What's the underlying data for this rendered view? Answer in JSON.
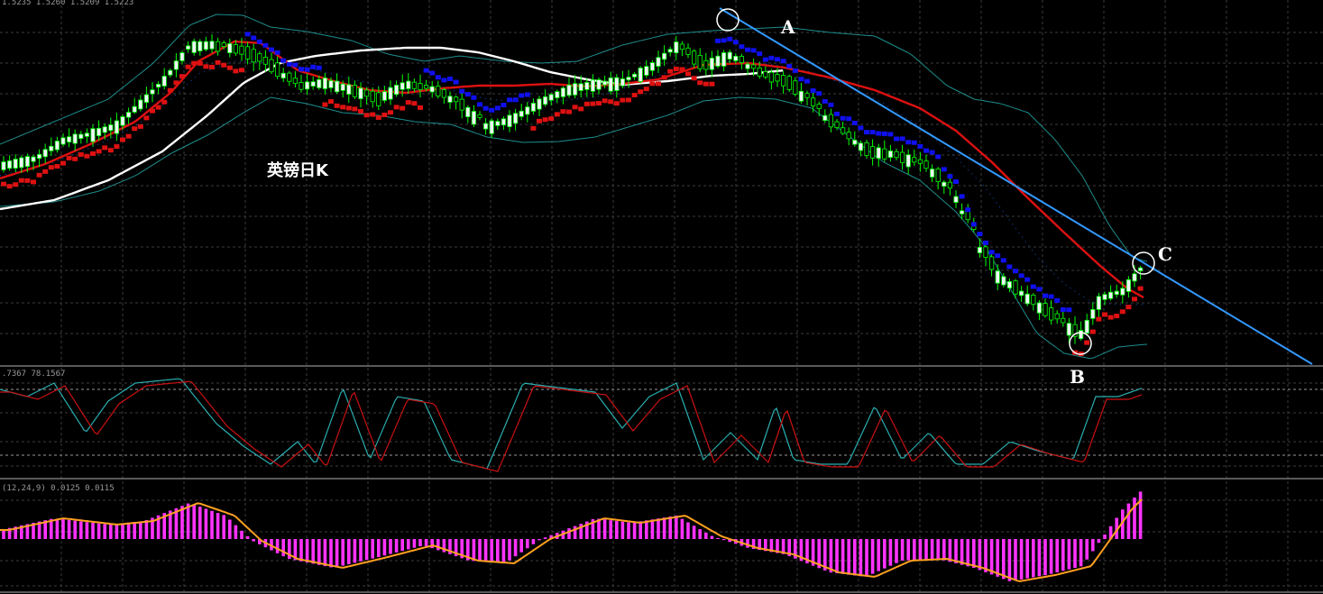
{
  "headers": {
    "main": "1.5235 1.5260 1.5209 1.5223",
    "stochastic": ".7367 78.1567",
    "macd": "(12,24,9) 0.0125 0.0115"
  },
  "colors": {
    "background": "#000000",
    "grid": "#3c3c3c",
    "bull_candle": "#f2f2ff",
    "bear_candle": "#000000",
    "wick": "#00ff00",
    "bollinger": "#1e8c8c",
    "ma_white": "#ffffff",
    "ma_red": "#dd1111",
    "trendline": "#3399ff",
    "psar_up": "#dd1111",
    "psar_down": "#1010ee",
    "stoch_k": "#2aaeb0",
    "stoch_d": "#cc1111",
    "macd_hist": "#ff33ff",
    "macd_signal": "#ffa020",
    "annotation": "#ffffff"
  },
  "chart_data": [
    {
      "type": "candlestick",
      "title": "英镑日K",
      "overlays": [
        "bollinger-bands",
        "moving-average-white",
        "moving-average-red",
        "parabolic-sar",
        "trendline"
      ],
      "annotations": [
        {
          "label": "A",
          "shape": "circle",
          "note": "swing high"
        },
        {
          "label": "B",
          "shape": "circle",
          "note": "swing low"
        },
        {
          "label": "C",
          "shape": "circle",
          "note": "touch of trendline"
        }
      ],
      "grid": true,
      "x_axis_labels": false,
      "y_axis_labels": false
    },
    {
      "type": "line",
      "series": [
        {
          "values": []
        },
        {
          "values": []
        }
      ],
      "levels": [
        80,
        20
      ],
      "grid": true
    },
    {
      "type": "bar",
      "series": [
        {
          "values": []
        },
        {
          "values": []
        }
      ],
      "grid": true
    }
  ]
}
